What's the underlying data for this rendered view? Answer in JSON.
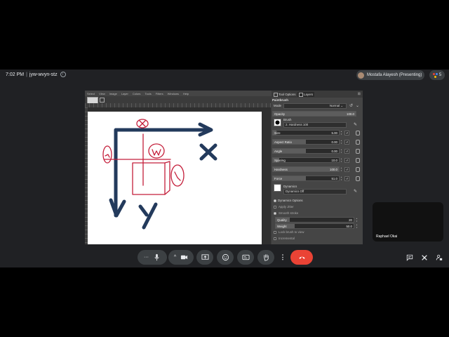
{
  "meeting": {
    "time": "7:02 PM",
    "code": "jyw-wvyn-stz",
    "presenter_label": "Mostafa Alayesh (Presenting)",
    "participant_count": "5",
    "self_tile_name": "Raphael Okai"
  },
  "gimp": {
    "menu": [
      "Select",
      "View",
      "Image",
      "Layer",
      "Colors",
      "Tools",
      "Filters",
      "Windows",
      "Help"
    ],
    "panel_tabs": [
      "Tool Options",
      "Layers"
    ],
    "tool_name": "Paintbrush",
    "mode_label": "Mode",
    "mode_value": "Normal",
    "opacity_label": "Opacity",
    "opacity_value": "100.0",
    "brush_label": "Brush",
    "brush_value": "2. Hardness 100",
    "sliders": [
      {
        "label": "Size",
        "value": "5.00",
        "fill": 0.05
      },
      {
        "label": "Aspect Ratio",
        "value": "0.00",
        "fill": 0.5
      },
      {
        "label": "Angle",
        "value": "0.00",
        "fill": 0.5
      },
      {
        "label": "Spacing",
        "value": "10.0",
        "fill": 0.1
      },
      {
        "label": "Hardness",
        "value": "100.0",
        "fill": 1.0
      },
      {
        "label": "Force",
        "value": "51.0",
        "fill": 0.5
      }
    ],
    "dynamics_label": "Dynamics",
    "dynamics_value": "Dynamics Off",
    "dynamics_options": "Dynamics Options",
    "apply_jitter": "Apply Jitter",
    "smooth_stroke": "Smooth stroke",
    "quality_label": "Quality",
    "quality_value": "20",
    "weight_label": "Weight",
    "weight_value": "50.0",
    "lock_brush": "Lock brush to view",
    "incremental": "Incremental"
  },
  "drawing": {
    "axis_x_label": "x",
    "axis_y_label": "y",
    "annotation_w": "w",
    "colors": {
      "navy": "#233a5c",
      "red": "#c41e3a"
    }
  },
  "colors": {
    "meet_bg": "#202124",
    "end_call": "#ea4335",
    "control_bg": "#3c4043"
  },
  "controls": [
    {
      "name": "more-options-icon"
    },
    {
      "name": "microphone-icon"
    },
    {
      "name": "camera-icon"
    },
    {
      "name": "present-screen-icon"
    },
    {
      "name": "emoji-icon"
    },
    {
      "name": "captions-icon"
    },
    {
      "name": "raise-hand-icon"
    },
    {
      "name": "more-vert-icon"
    },
    {
      "name": "end-call-icon"
    }
  ]
}
